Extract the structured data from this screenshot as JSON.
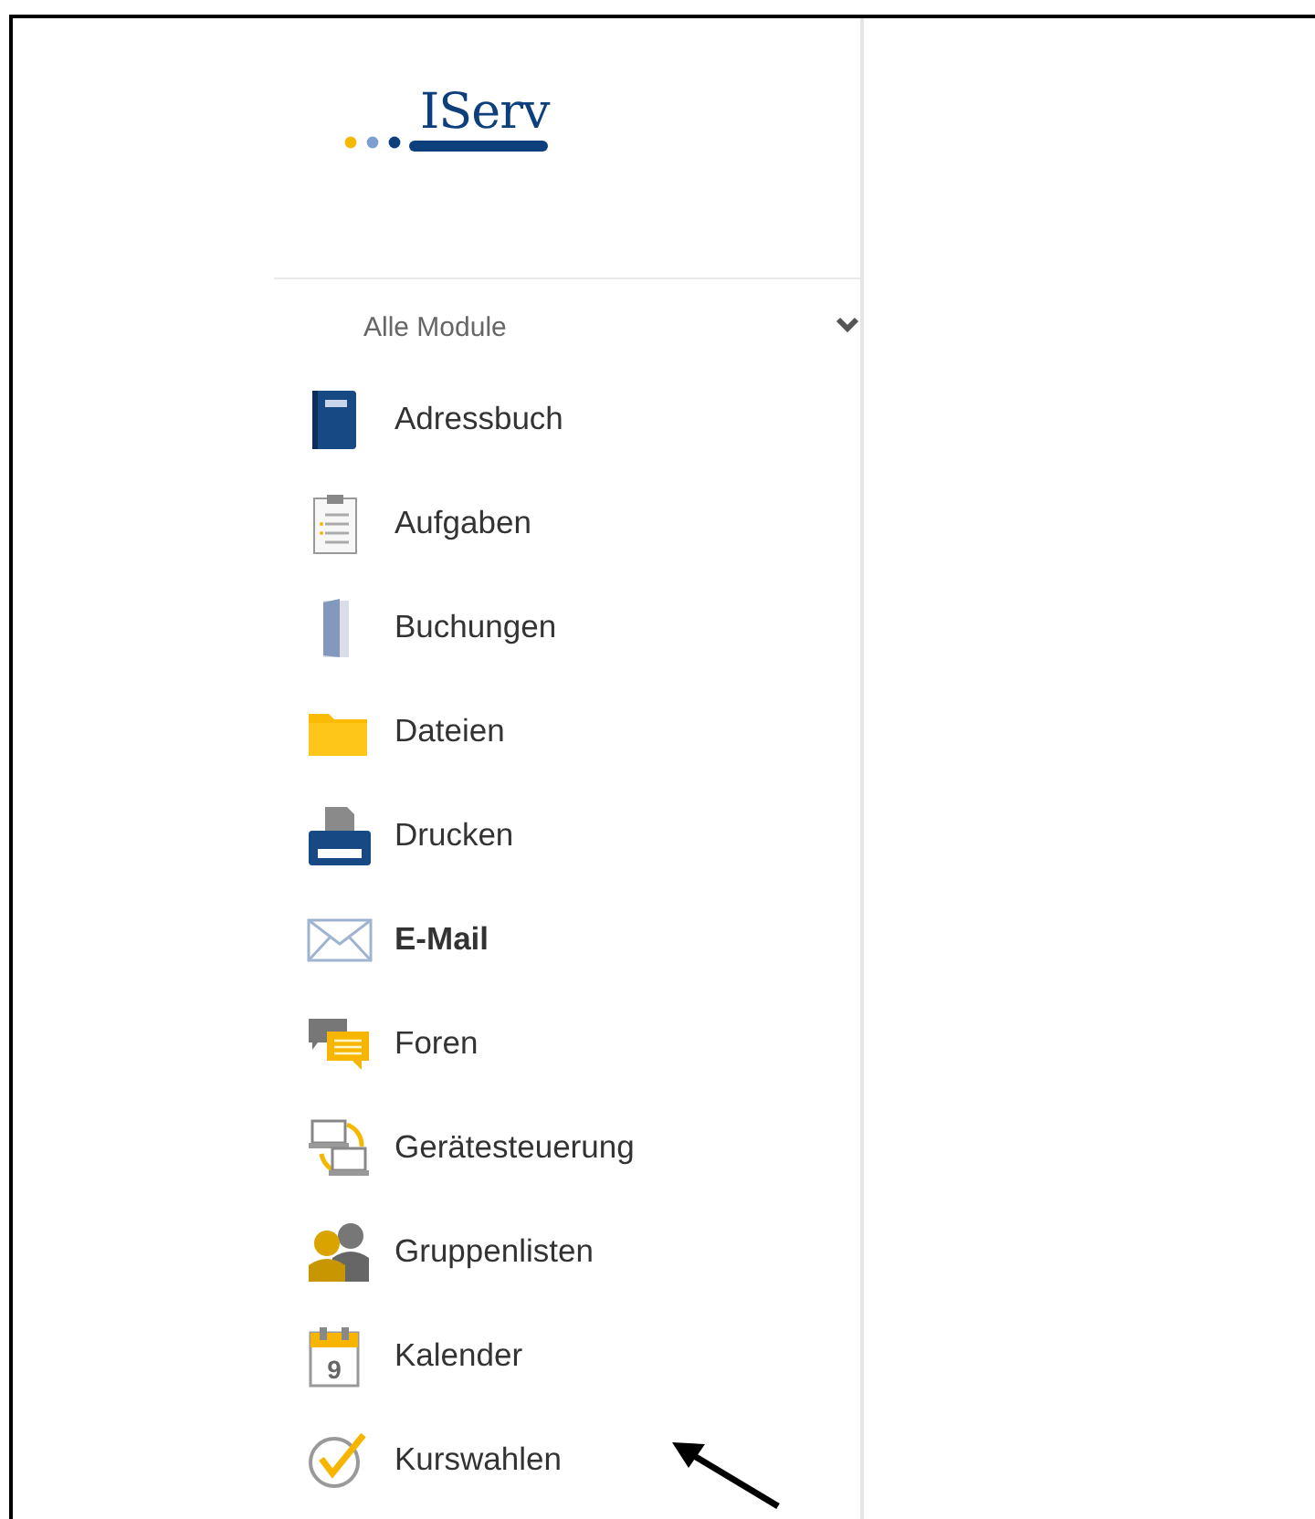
{
  "logo": {
    "text": "IServ"
  },
  "module_menu": {
    "label": "Alle Module",
    "expanded": true
  },
  "items": [
    {
      "kind": "addressbook",
      "label": "Adressbuch",
      "bold": false
    },
    {
      "kind": "tasks",
      "label": "Aufgaben",
      "bold": false
    },
    {
      "kind": "booking",
      "label": "Buchungen",
      "bold": false
    },
    {
      "kind": "files",
      "label": "Dateien",
      "bold": false
    },
    {
      "kind": "print",
      "label": "Drucken",
      "bold": false
    },
    {
      "kind": "mail",
      "label": "E-Mail",
      "bold": true
    },
    {
      "kind": "forum",
      "label": "Foren",
      "bold": false
    },
    {
      "kind": "devices",
      "label": "Gerätesteuerung",
      "bold": false
    },
    {
      "kind": "groups",
      "label": "Gruppenlisten",
      "bold": false
    },
    {
      "kind": "calendar",
      "label": "Kalender",
      "bold": false,
      "icon_text": "9"
    },
    {
      "kind": "courses",
      "label": "Kurswahlen",
      "bold": false
    }
  ]
}
